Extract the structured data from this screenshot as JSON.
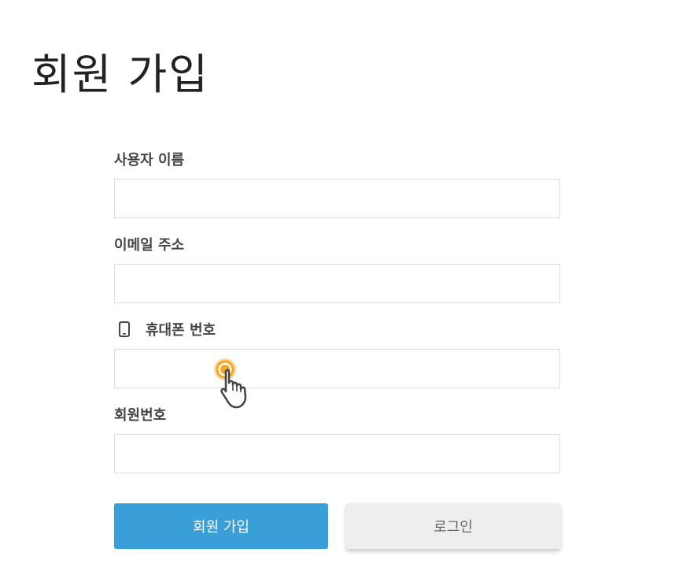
{
  "page": {
    "title": "회원 가입"
  },
  "form": {
    "fields": [
      {
        "label": "사용자 이름",
        "value": "",
        "placeholder": ""
      },
      {
        "label": "이메일 주소",
        "value": "",
        "placeholder": ""
      },
      {
        "label": "휴대폰 번호",
        "value": "",
        "placeholder": "",
        "icon": "phone-icon"
      },
      {
        "label": "회원번호",
        "value": "",
        "placeholder": ""
      }
    ]
  },
  "buttons": {
    "signup_label": "회원 가입",
    "login_label": "로그인"
  },
  "colors": {
    "primary": "#3a9fd8",
    "secondary": "#eeeeee",
    "cursor_highlight": "#f5a623"
  },
  "cursor": {
    "icon": "hand-pointer-icon"
  }
}
